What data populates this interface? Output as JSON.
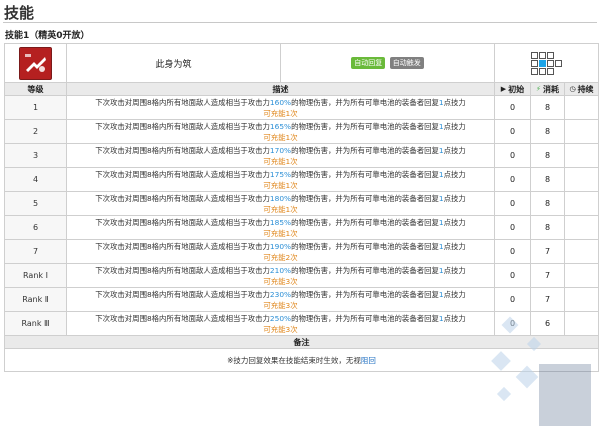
{
  "page": {
    "title": "技能",
    "subtitle": "技能1（精英0开放）"
  },
  "skill": {
    "name": "此身为筑",
    "badges": [
      "自动回复",
      "自动触发"
    ]
  },
  "headers": {
    "level": "等级",
    "desc": "描述",
    "initial": "初始",
    "cost": "消耗",
    "duration": "持续"
  },
  "rows": [
    {
      "level": "1",
      "pct": "160%",
      "charges": "1",
      "initial": "0",
      "cost": "8",
      "duration": ""
    },
    {
      "level": "2",
      "pct": "165%",
      "charges": "1",
      "initial": "0",
      "cost": "8",
      "duration": ""
    },
    {
      "level": "3",
      "pct": "170%",
      "charges": "1",
      "initial": "0",
      "cost": "8",
      "duration": ""
    },
    {
      "level": "4",
      "pct": "175%",
      "charges": "1",
      "initial": "0",
      "cost": "8",
      "duration": ""
    },
    {
      "level": "5",
      "pct": "180%",
      "charges": "1",
      "initial": "0",
      "cost": "8",
      "duration": ""
    },
    {
      "level": "6",
      "pct": "185%",
      "charges": "1",
      "initial": "0",
      "cost": "8",
      "duration": ""
    },
    {
      "level": "7",
      "pct": "190%",
      "charges": "2",
      "initial": "0",
      "cost": "7",
      "duration": ""
    },
    {
      "level": "Rank Ⅰ",
      "pct": "210%",
      "charges": "3",
      "initial": "0",
      "cost": "7",
      "duration": ""
    },
    {
      "level": "Rank Ⅱ",
      "pct": "230%",
      "charges": "3",
      "initial": "0",
      "cost": "7",
      "duration": ""
    },
    {
      "level": "Rank Ⅲ",
      "pct": "250%",
      "charges": "3",
      "initial": "0",
      "cost": "6",
      "duration": ""
    }
  ],
  "desc_parts": {
    "before": "下次攻击对周围8格内所有地面敌人造成相当于攻击力",
    "after_pct": "的物理伤害，并为所有可靠电池的装备者回复",
    "point_num": "1",
    "after_point": "点技力",
    "charge_prefix": "可充能",
    "charge_suffix": "次"
  },
  "notes": {
    "header": "备注",
    "text": "※技力回复效果在技能结束时生效，无视",
    "link": "阻回"
  },
  "colors": {
    "highlight": "#2b8fd6",
    "charge": "#e0861a",
    "badge_green": "#6aba3a",
    "badge_gray": "#808080",
    "range_self": "#1aa3e8"
  }
}
